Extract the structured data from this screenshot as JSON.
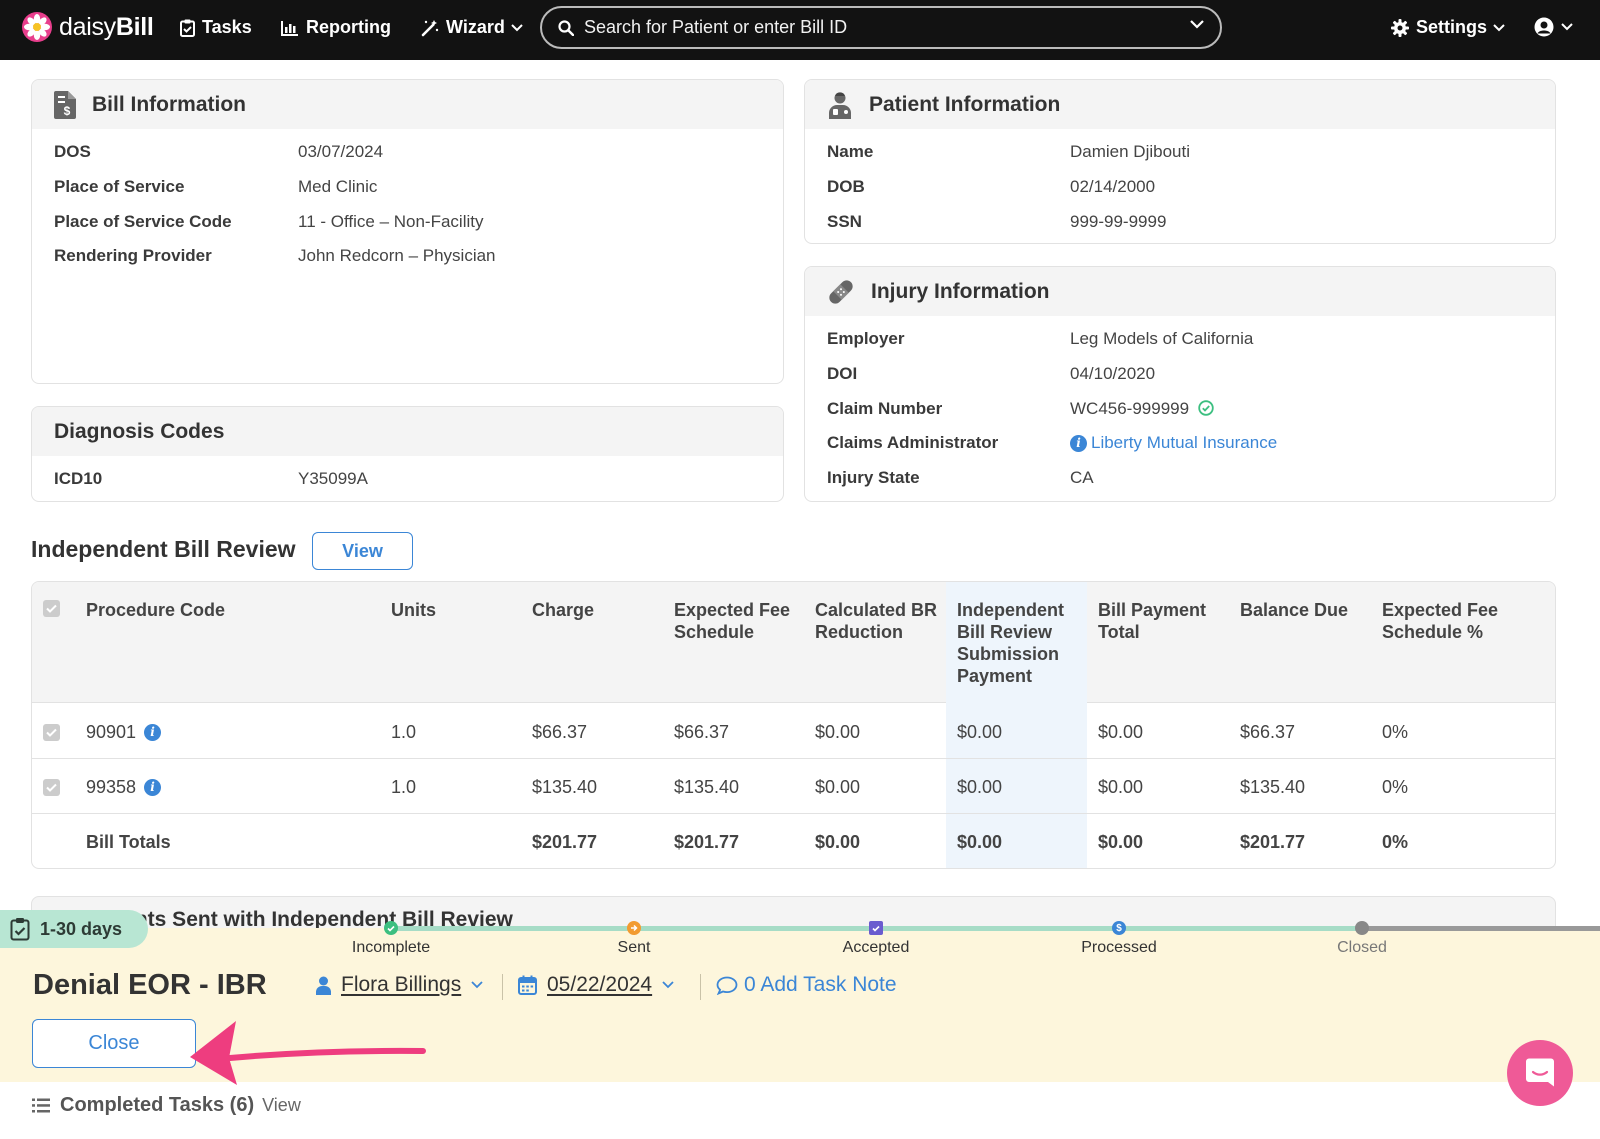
{
  "nav": {
    "logo_text_light": "daisy",
    "logo_text_bold": "Bill",
    "tasks": "Tasks",
    "reporting": "Reporting",
    "wizard": "Wizard",
    "search_placeholder": "Search for Patient or enter Bill ID",
    "settings": "Settings"
  },
  "bill_info": {
    "title": "Bill Information",
    "rows": [
      {
        "label": "DOS",
        "value": "03/07/2024"
      },
      {
        "label": "Place of Service",
        "value": "Med Clinic"
      },
      {
        "label": "Place of Service Code",
        "value": "11 - Office – Non-Facility"
      },
      {
        "label": "Rendering Provider",
        "value": "John Redcorn – Physician"
      }
    ]
  },
  "patient_info": {
    "title": "Patient Information",
    "rows": [
      {
        "label": "Name",
        "value": "Damien Djibouti"
      },
      {
        "label": "DOB",
        "value": "02/14/2000"
      },
      {
        "label": "SSN",
        "value": "999-99-9999"
      }
    ]
  },
  "diagnosis": {
    "title": "Diagnosis Codes",
    "rows": [
      {
        "label": "ICD10",
        "value": "Y35099A"
      }
    ]
  },
  "injury_info": {
    "title": "Injury Information",
    "rows": [
      {
        "label": "Employer",
        "value": "Leg Models of California"
      },
      {
        "label": "DOI",
        "value": "04/10/2020"
      },
      {
        "label": "Claim Number",
        "value": "WC456-999999"
      },
      {
        "label": "Claims Administrator",
        "value": "Liberty Mutual Insurance"
      },
      {
        "label": "Injury State",
        "value": "CA"
      }
    ]
  },
  "ibr": {
    "title": "Independent Bill Review",
    "view_label": "View",
    "headers": [
      "Procedure Code",
      "Units",
      "Charge",
      "Expected Fee Schedule",
      "Calculated BR Reduction",
      "Independent Bill Review Submission Payment",
      "Bill Payment Total",
      "Balance Due",
      "Expected Fee Schedule %"
    ],
    "rows": [
      {
        "code": "90901",
        "units": "1.0",
        "charge": "$66.37",
        "efs": "$66.37",
        "br": "$0.00",
        "ibr_pay": "$0.00",
        "bill_pay": "$0.00",
        "balance": "$66.37",
        "pct": "0%"
      },
      {
        "code": "99358",
        "units": "1.0",
        "charge": "$135.40",
        "efs": "$135.40",
        "br": "$0.00",
        "ibr_pay": "$0.00",
        "bill_pay": "$0.00",
        "balance": "$135.40",
        "pct": "0%"
      }
    ],
    "totals": {
      "label": "Bill Totals",
      "charge": "$201.77",
      "efs": "$201.77",
      "br": "$0.00",
      "ibr_pay": "$0.00",
      "bill_pay": "$0.00",
      "balance": "$201.77",
      "pct": "0%"
    }
  },
  "behind_card_title": "Documents Sent with Independent Bill Review",
  "task": {
    "days_badge": "1-30 days",
    "steps": [
      "Incomplete",
      "Sent",
      "Accepted",
      "Processed",
      "Closed"
    ],
    "title": "Denial EOR - IBR",
    "assignee": "Flora Billings",
    "due_date": "05/22/2024",
    "note_label": "0 Add Task Note",
    "close_label": "Close"
  },
  "completed": {
    "label": "Completed Tasks (6)",
    "view": "View"
  },
  "colors": {
    "accent_blue": "#3b86d6",
    "nav_bg": "#121212",
    "task_bg": "#fdf6dc",
    "badge_green": "#b8e6d3",
    "arrow_pink": "#ee3d7f",
    "chat_pink": "#ef5a97"
  }
}
